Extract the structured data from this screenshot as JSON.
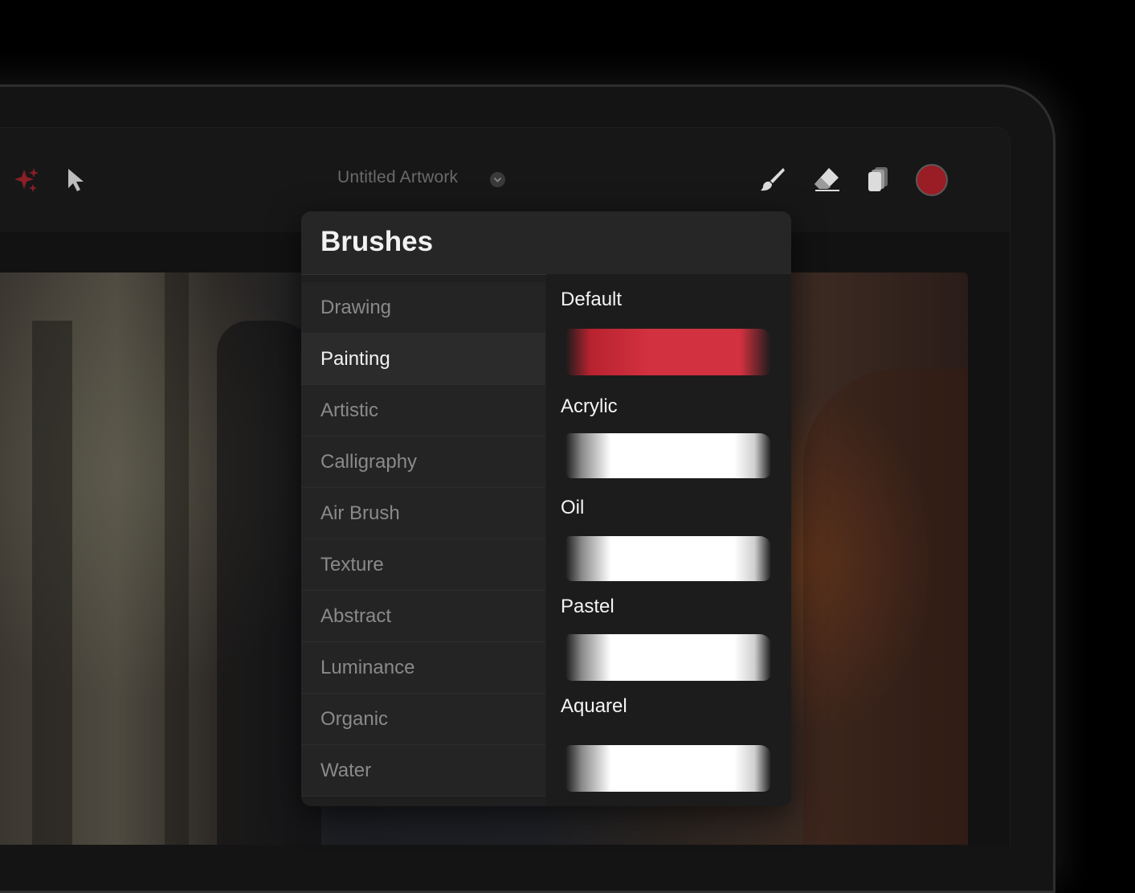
{
  "toolbar": {
    "title": "Untitled Artwork",
    "left_icons": [
      "sparkle-icon",
      "cursor-icon"
    ],
    "right_icons": [
      "brush-icon",
      "eraser-icon",
      "layers-icon"
    ],
    "color_swatch": "#9a1d25"
  },
  "brushes_panel": {
    "title": "Brushes",
    "categories": [
      {
        "label": "Drawing"
      },
      {
        "label": "Painting"
      },
      {
        "label": "Artistic"
      },
      {
        "label": "Calligraphy"
      },
      {
        "label": "Air Brush"
      },
      {
        "label": "Texture"
      },
      {
        "label": "Abstract"
      },
      {
        "label": "Luminance"
      },
      {
        "label": "Organic"
      },
      {
        "label": "Water"
      }
    ],
    "selected_category": "Painting",
    "brushes": [
      {
        "name": "Default",
        "color": "#d2313f"
      },
      {
        "name": "Acrylic",
        "color": "#ffffff"
      },
      {
        "name": "Oil",
        "color": "#ffffff"
      },
      {
        "name": "Pastel",
        "color": "#ffffff"
      },
      {
        "name": "Aquarel",
        "color": "#ffffff"
      }
    ]
  }
}
